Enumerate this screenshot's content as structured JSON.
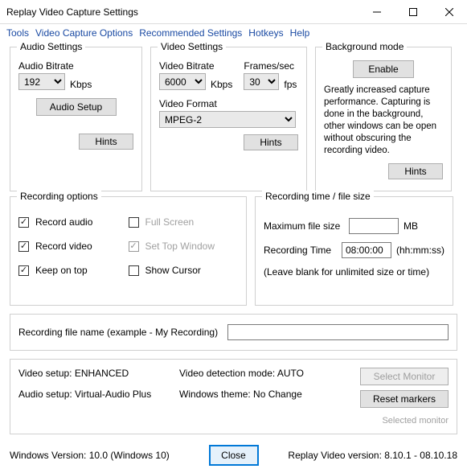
{
  "window": {
    "title": "Replay Video Capture Settings"
  },
  "menu": {
    "tools": "Tools",
    "vco": "Video Capture Options",
    "rec": "Recommended Settings",
    "hot": "Hotkeys",
    "help": "Help"
  },
  "audio": {
    "title": "Audio Settings",
    "bitrate_label": "Audio Bitrate",
    "bitrate_value": "192",
    "kbps": "Kbps",
    "setup_btn": "Audio Setup",
    "hints": "Hints"
  },
  "video": {
    "title": "Video Settings",
    "bitrate_label": "Video Bitrate",
    "bitrate_value": "6000",
    "kbps": "Kbps",
    "fps_label": "Frames/sec",
    "fps_value": "30",
    "fps": "fps",
    "format_label": "Video Format",
    "format_value": "MPEG-2",
    "hints": "Hints"
  },
  "bg": {
    "title": "Background mode",
    "enable": "Enable",
    "desc": "Greatly increased capture performance. Capturing is done in the background, other windows can be open without obscuring the recording video.",
    "hints": "Hints"
  },
  "recopts": {
    "title": "Recording options",
    "record_audio": "Record audio",
    "record_video": "Record video",
    "keep_on_top": "Keep on top",
    "full_screen": "Full Screen",
    "set_top_window": "Set Top Window",
    "show_cursor": "Show Cursor"
  },
  "rectime": {
    "title": "Recording time / file size",
    "max_size_label": "Maximum file size",
    "max_size_value": "",
    "mb": "MB",
    "rec_time_label": "Recording Time",
    "rec_time_value": "08:00:00",
    "hhmmss": "(hh:mm:ss)",
    "note": "(Leave blank for unlimited size or time)"
  },
  "filename": {
    "label": "Recording file name (example -  My Recording)",
    "value": ""
  },
  "setup": {
    "video_setup": "Video setup: ENHANCED",
    "audio_setup": "Audio setup: Virtual-Audio Plus",
    "detection": "Video detection mode: AUTO",
    "theme": "Windows theme: No Change",
    "select_monitor": "Select Monitor",
    "reset_markers": "Reset markers",
    "selected_monitor": "Selected monitor"
  },
  "footer": {
    "winver": "Windows Version: 10.0 (Windows 10)",
    "close": "Close",
    "appver": "Replay Video version: 8.10.1 - 08.10.18"
  }
}
